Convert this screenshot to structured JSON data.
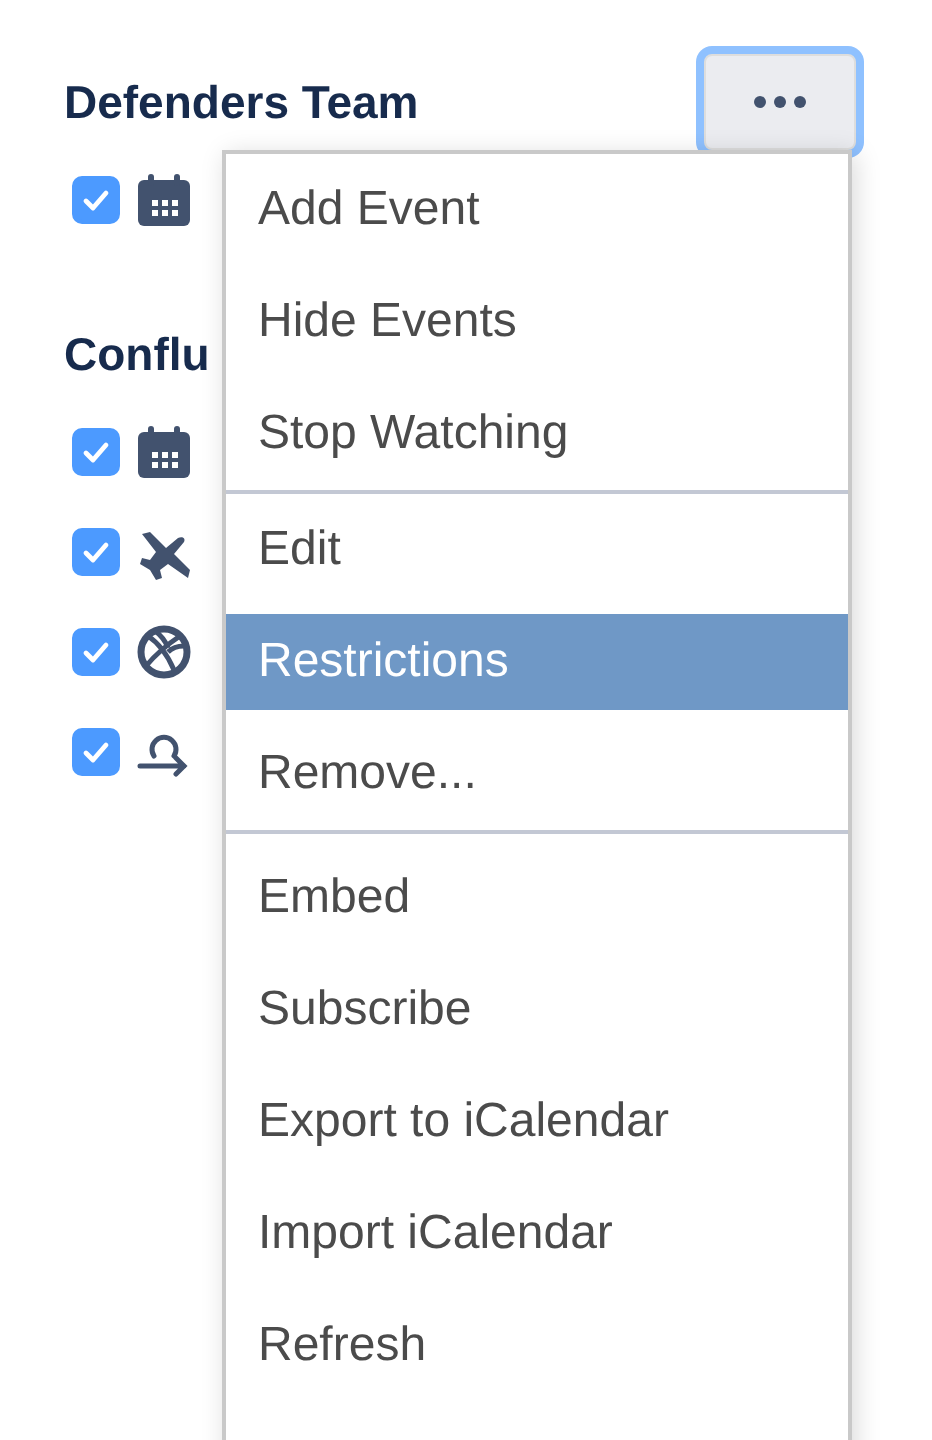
{
  "groups": [
    {
      "title": "Defenders Team",
      "calendars": [
        {
          "kind": "calendar",
          "checked": true
        }
      ]
    },
    {
      "title": "Conflu",
      "calendars": [
        {
          "kind": "calendar",
          "checked": true
        },
        {
          "kind": "plane",
          "checked": true
        },
        {
          "kind": "ball",
          "checked": true
        },
        {
          "kind": "route",
          "checked": true
        }
      ]
    }
  ],
  "more_button": {
    "focused": true
  },
  "menu": {
    "sections": [
      [
        {
          "label": "Add Event",
          "selected": false
        },
        {
          "label": "Hide Events",
          "selected": false
        },
        {
          "label": "Stop Watching",
          "selected": false
        }
      ],
      [
        {
          "label": "Edit",
          "selected": false
        },
        {
          "label": "Restrictions",
          "selected": true
        },
        {
          "label": "Remove...",
          "selected": false
        }
      ],
      [
        {
          "label": "Embed",
          "selected": false
        },
        {
          "label": "Subscribe",
          "selected": false
        },
        {
          "label": "Export to iCalendar",
          "selected": false
        },
        {
          "label": "Import iCalendar",
          "selected": false
        },
        {
          "label": "Refresh",
          "selected": false
        }
      ]
    ]
  }
}
